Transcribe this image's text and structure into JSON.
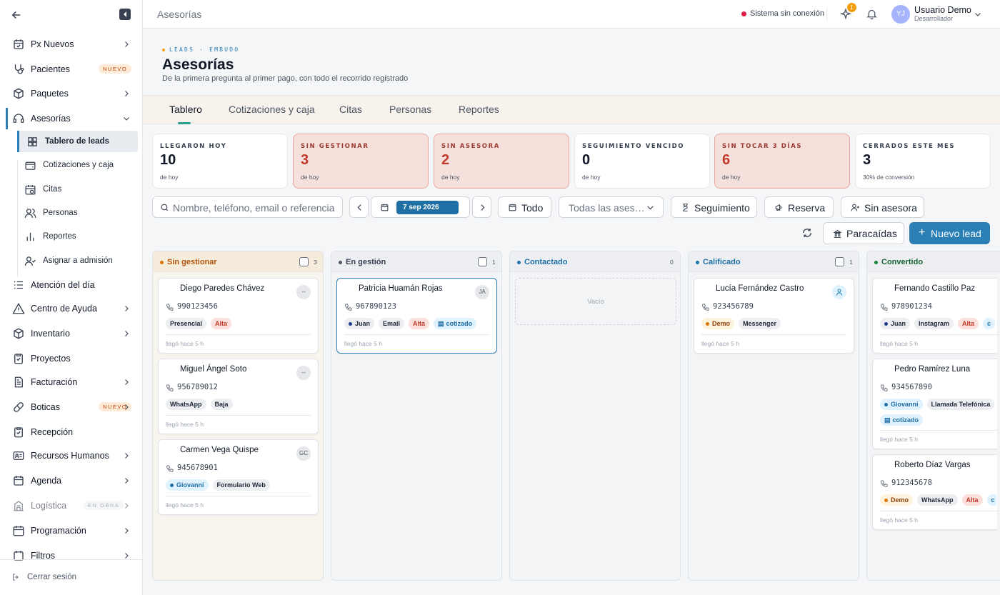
{
  "header": {
    "title": "Asesorías",
    "status": "Sistema sin conexión",
    "notif_count": "1",
    "user_initials": "YJ",
    "user_name": "Usuario Demo",
    "user_role": "Desarrollador"
  },
  "sidebar": {
    "items": [
      {
        "label": "Px Nuevos"
      },
      {
        "label": "Pacientes",
        "badge": "NUEVO"
      },
      {
        "label": "Paquetes"
      },
      {
        "label": "Asesorías"
      },
      {
        "label": "Atención del día"
      },
      {
        "label": "Centro de Ayuda"
      },
      {
        "label": "Inventario"
      },
      {
        "label": "Proyectos"
      },
      {
        "label": "Facturación"
      },
      {
        "label": "Boticas",
        "badge": "NUEVO"
      },
      {
        "label": "Recepción"
      },
      {
        "label": "Recursos Humanos"
      },
      {
        "label": "Agenda"
      },
      {
        "label": "Logística",
        "badge": "EN OBRA"
      },
      {
        "label": "Programación"
      },
      {
        "label": "Filtros"
      }
    ],
    "sub_items": [
      {
        "label": "Tablero de leads"
      },
      {
        "label": "Cotizaciones y caja"
      },
      {
        "label": "Citas"
      },
      {
        "label": "Personas"
      },
      {
        "label": "Reportes"
      },
      {
        "label": "Asignar a admisión"
      }
    ],
    "logout": "Cerrar sesión"
  },
  "page": {
    "eyebrow": "LEADS · EMBUDO",
    "title": "Asesorías",
    "subtitle": "De la primera pregunta al primer pago, con todo el recorrido registrado"
  },
  "tabs": [
    "Tablero",
    "Cotizaciones y caja",
    "Citas",
    "Personas",
    "Reportes"
  ],
  "stats": [
    {
      "label": "LLEGARON HOY",
      "value": "10",
      "foot": "de hoy"
    },
    {
      "label": "SIN GESTIONAR",
      "value": "3",
      "foot": "de hoy"
    },
    {
      "label": "SIN ASESORA",
      "value": "2",
      "foot": "de hoy"
    },
    {
      "label": "SEGUIMIENTO VENCIDO",
      "value": "0",
      "foot": "de hoy"
    },
    {
      "label": "SIN TOCAR 3 DÍAS",
      "value": "6",
      "foot": "de hoy"
    },
    {
      "label": "CERRADOS ESTE MES",
      "value": "3",
      "foot": "30% de conversión"
    }
  ],
  "toolbar": {
    "search_placeholder": "Nombre, teléfono, email o referencia",
    "date": "7 sep 2026",
    "range": "Todo",
    "asesora_select": "Todas las ases…",
    "seguimiento": "Seguimiento",
    "reserva": "Reserva",
    "sin_asesora": "Sin asesora",
    "paracaidas": "Paracaídas",
    "nuevo_lead": "Nuevo lead"
  },
  "colors": {
    "accent": "#2a7fb5",
    "alert": "#c0392b",
    "warn": "#f59e0b"
  },
  "board": {
    "columns": [
      {
        "title": "Sin gestionar",
        "count": "3",
        "color": "#d97706",
        "cards": [
          {
            "name": "Diego Paredes Chávez",
            "avatar": "--",
            "phone": "990123456",
            "tags": [
              "Presencial",
              "Alta"
            ],
            "arrived": "llegó hace 5 h"
          },
          {
            "name": "Miguel Ángel Soto",
            "avatar": "--",
            "phone": "956789012",
            "tags": [
              "WhatsApp",
              "Baja"
            ],
            "arrived": "llegó hace 5 h"
          },
          {
            "name": "Carmen Vega Quispe",
            "avatar": "GC",
            "phone": "945678901",
            "tags": [
              "Giovanni",
              "Formulario Web"
            ],
            "arrived": "llegó hace 5 h"
          }
        ]
      },
      {
        "title": "En gestión",
        "count": "1",
        "color": "#4b5563",
        "cards": [
          {
            "name": "Patricia Huamán Rojas",
            "avatar": "JA",
            "phone": "967890123",
            "tags": [
              "Juan",
              "Email",
              "Alta",
              "cotizado"
            ],
            "arrived": "llegó hace 5 h"
          }
        ]
      },
      {
        "title": "Contactado",
        "count": "0",
        "color": "#1f6fa5",
        "empty": "Vacío",
        "cards": []
      },
      {
        "title": "Calificado",
        "count": "1",
        "color": "#1f6fa5",
        "cards": [
          {
            "name": "Lucía Fernández Castro",
            "phone": "923456789",
            "tags": [
              "Demo",
              "Messenger"
            ],
            "arrived": "llegó hace 5 h"
          }
        ]
      },
      {
        "title": "Convertido",
        "color": "#15803d",
        "cards": [
          {
            "name": "Fernando Castillo Paz",
            "phone": "978901234",
            "tags": [
              "Juan",
              "Instagram",
              "Alta",
              "c"
            ],
            "arrived": "llegó hace 5 h"
          },
          {
            "name": "Pedro Ramírez Luna",
            "phone": "934567890",
            "tags": [
              "Giovanni",
              "Llamada Telefónica"
            ],
            "tags2": [
              "cotizado"
            ],
            "arrived": "llegó hace 5 h"
          },
          {
            "name": "Roberto Díaz Vargas",
            "phone": "912345678",
            "tags": [
              "Demo",
              "WhatsApp",
              "Alta",
              "c"
            ],
            "arrived": "llegó hace 5 h"
          }
        ]
      }
    ]
  }
}
